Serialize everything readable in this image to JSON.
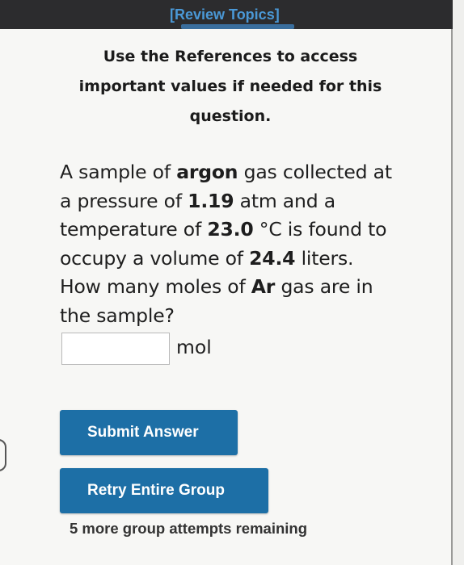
{
  "header": {
    "review_link": "[Review Topics]"
  },
  "notice": {
    "references_line1": "Use the References to access",
    "references_line2": "important values if needed for this",
    "references_line3": "question."
  },
  "question": {
    "p1": "A sample of ",
    "gas": "argon",
    "p2": " gas collected at a pressure of ",
    "pressure": "1.19",
    "p3": " atm and a temperature of ",
    "temperature": "23.0",
    "p4": " °C is found to occupy a volume of ",
    "volume": "24.4",
    "p5": " liters. How many moles of ",
    "symbol": "Ar",
    "p6": " gas are in the sample?"
  },
  "answer": {
    "value": "",
    "placeholder": "",
    "unit": "mol"
  },
  "buttons": {
    "submit": "Submit Answer",
    "retry": "Retry Entire Group"
  },
  "status": {
    "attempts": "5 more group attempts remaining"
  },
  "colors": {
    "accent": "#1d6fa6",
    "link": "#4a98d6",
    "topbar": "#2c2c2e"
  }
}
